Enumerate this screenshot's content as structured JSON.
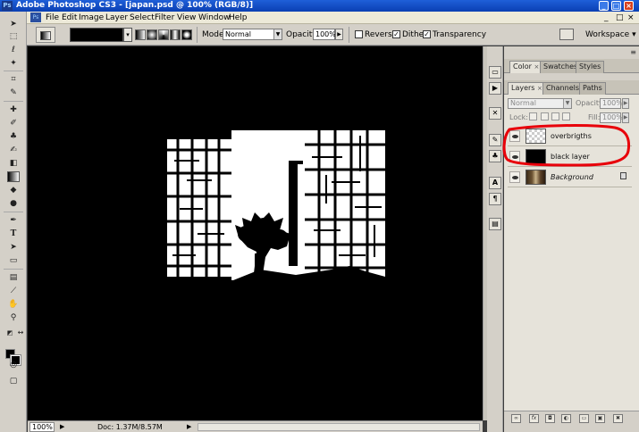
{
  "window": {
    "app_logo": "Ps",
    "title": "Adobe Photoshop CS3 - [japan.psd @ 100% (RGB/8)]",
    "controls": [
      "_",
      "□",
      "×"
    ]
  },
  "menubar": {
    "app_icon": "Ps",
    "items": [
      "File",
      "Edit",
      "Image",
      "Layer",
      "Select",
      "Filter",
      "View",
      "Window",
      "Help"
    ],
    "doc_controls": [
      "_",
      "□",
      "×"
    ]
  },
  "options_bar": {
    "mode_label": "Mode:",
    "mode_value": "Normal",
    "opacity_label": "Opacity:",
    "opacity_value": "100%",
    "reverse_label": "Reverse",
    "reverse_checked": false,
    "dither_label": "Dither",
    "dither_checked": true,
    "transparency_label": "Transparency",
    "transparency_checked": true,
    "workspace_label": "Workspace"
  },
  "toolbox": {
    "tools": [
      "move-tool",
      "marquee-tool",
      "lasso-tool",
      "magic-wand-tool",
      "crop-tool",
      "slice-tool",
      "healing-brush-tool",
      "brush-tool",
      "clone-stamp-tool",
      "history-brush-tool",
      "eraser-tool",
      "gradient-tool",
      "blur-tool",
      "dodge-tool",
      "pen-tool",
      "type-tool",
      "path-selection-tool",
      "shape-tool",
      "notes-tool",
      "eyedropper-tool",
      "hand-tool",
      "zoom-tool"
    ],
    "colors": {
      "foreground": "#000000",
      "background": "#000000"
    }
  },
  "statusbar": {
    "zoom": "100%",
    "doc_info": "Doc: 1.37M/8.57M"
  },
  "color_panel": {
    "tabs": [
      {
        "label": "Color",
        "active": true,
        "closable": true
      },
      {
        "label": "Swatches",
        "active": false,
        "closable": false
      },
      {
        "label": "Styles",
        "active": false,
        "closable": false
      }
    ]
  },
  "layers_panel": {
    "tabs": [
      {
        "label": "Layers",
        "active": true,
        "closable": true
      },
      {
        "label": "Channels",
        "active": false,
        "closable": false
      },
      {
        "label": "Paths",
        "active": false,
        "closable": false
      }
    ],
    "blend_mode": "Normal",
    "opacity_label": "Opacity:",
    "opacity_value": "100%",
    "lock_label": "Lock:",
    "fill_label": "Fill:",
    "fill_value": "100%",
    "layers": [
      {
        "name": "overbrigths",
        "thumbnail": "transparent",
        "visible": true,
        "italic": false,
        "locked": false
      },
      {
        "name": "black layer",
        "thumbnail": "black",
        "visible": true,
        "italic": false,
        "locked": false
      },
      {
        "name": "Background",
        "thumbnail": "photo",
        "visible": true,
        "italic": true,
        "locked": true
      }
    ]
  },
  "colors": {
    "titlebar": "#0a3fb3",
    "chrome": "#d4d0c8",
    "canvas_bg": "#000000",
    "annotation": "#e8000a"
  }
}
